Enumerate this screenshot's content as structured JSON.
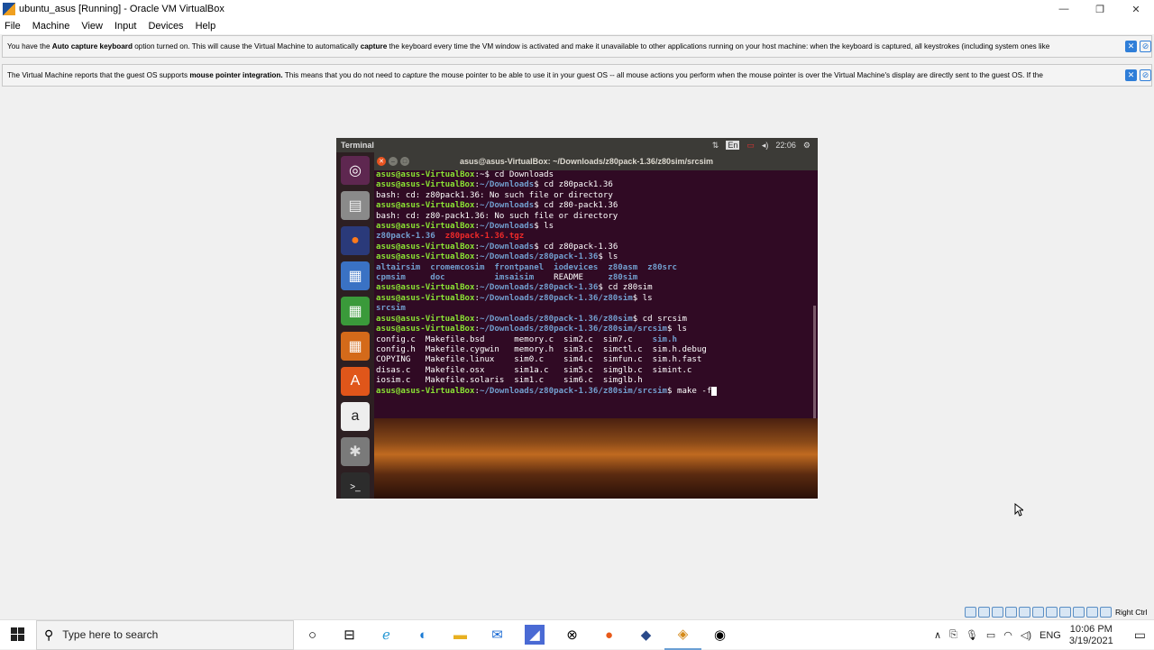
{
  "window": {
    "title": "ubuntu_asus [Running] - Oracle VM VirtualBox",
    "minimize": "—",
    "restore": "❐",
    "close": "✕"
  },
  "menu": [
    "File",
    "Machine",
    "View",
    "Input",
    "Devices",
    "Help"
  ],
  "notices": [
    {
      "parts": [
        {
          "t": "You have the ",
          "b": false
        },
        {
          "t": "Auto capture keyboard",
          "b": true
        },
        {
          "t": " option turned on. This will cause the Virtual Machine to automatically ",
          "b": false
        },
        {
          "t": "capture",
          "b": true
        },
        {
          "t": " the keyboard every time the VM window is activated and make it unavailable to other applications running on your host machine: when the keyboard is captured, all keystrokes (including system ones like",
          "b": false
        }
      ]
    },
    {
      "parts": [
        {
          "t": "The Virtual Machine reports that the guest OS supports ",
          "b": false
        },
        {
          "t": "mouse pointer integration.",
          "b": true
        },
        {
          "t": " This means that you do not need to ",
          "b": false
        },
        {
          "t": "capture",
          "b": false,
          "i": true
        },
        {
          "t": " the mouse pointer to be able to use it in your guest OS -- all mouse actions you perform when the mouse pointer is over the Virtual Machine's display are directly sent to the guest OS. If the",
          "b": false
        }
      ]
    }
  ],
  "guest": {
    "topbar_title": "Terminal",
    "lang": "En",
    "time": "22:06",
    "terminal_title": "asus@asus-VirtualBox: ~/Downloads/z80pack-1.36/z80sim/srcsim",
    "lines": [
      [
        {
          "c": "p-user",
          "t": "asus@asus-VirtualBox"
        },
        {
          "c": "",
          "t": ":~$ cd Downloads"
        }
      ],
      [
        {
          "c": "p-user",
          "t": "asus@asus-VirtualBox"
        },
        {
          "c": "",
          "t": ":"
        },
        {
          "c": "p-path",
          "t": "~/Downloads"
        },
        {
          "c": "",
          "t": "$ cd z80pack1.36"
        }
      ],
      [
        {
          "c": "",
          "t": "bash: cd: z80pack1.36: No such file or directory"
        }
      ],
      [
        {
          "c": "p-user",
          "t": "asus@asus-VirtualBox"
        },
        {
          "c": "",
          "t": ":"
        },
        {
          "c": "p-path",
          "t": "~/Downloads"
        },
        {
          "c": "",
          "t": "$ cd z80-pack1.36"
        }
      ],
      [
        {
          "c": "",
          "t": "bash: cd: z80-pack1.36: No such file or directory"
        }
      ],
      [
        {
          "c": "p-user",
          "t": "asus@asus-VirtualBox"
        },
        {
          "c": "",
          "t": ":"
        },
        {
          "c": "p-path",
          "t": "~/Downloads"
        },
        {
          "c": "",
          "t": "$ ls"
        }
      ],
      [
        {
          "c": "c-dir",
          "t": "z80pack-1.36"
        },
        {
          "c": "",
          "t": "  "
        },
        {
          "c": "c-red",
          "t": "z80pack-1.36.tgz"
        }
      ],
      [
        {
          "c": "p-user",
          "t": "asus@asus-VirtualBox"
        },
        {
          "c": "",
          "t": ":"
        },
        {
          "c": "p-path",
          "t": "~/Downloads"
        },
        {
          "c": "",
          "t": "$ cd z80pack-1.36"
        }
      ],
      [
        {
          "c": "p-user",
          "t": "asus@asus-VirtualBox"
        },
        {
          "c": "",
          "t": ":"
        },
        {
          "c": "p-path",
          "t": "~/Downloads/z80pack-1.36"
        },
        {
          "c": "",
          "t": "$ ls"
        }
      ],
      [
        {
          "c": "c-dir",
          "t": "altairsim  cromemcosim  frontpanel  iodevices  z80asm  z80src"
        }
      ],
      [
        {
          "c": "c-dir",
          "t": "cpmsim     doc          imsaisim    "
        },
        {
          "c": "",
          "t": "README     "
        },
        {
          "c": "c-dir",
          "t": "z80sim"
        }
      ],
      [
        {
          "c": "p-user",
          "t": "asus@asus-VirtualBox"
        },
        {
          "c": "",
          "t": ":"
        },
        {
          "c": "p-path",
          "t": "~/Downloads/z80pack-1.36"
        },
        {
          "c": "",
          "t": "$ cd z80sim"
        }
      ],
      [
        {
          "c": "p-user",
          "t": "asus@asus-VirtualBox"
        },
        {
          "c": "",
          "t": ":"
        },
        {
          "c": "p-path",
          "t": "~/Downloads/z80pack-1.36/z80sim"
        },
        {
          "c": "",
          "t": "$ ls"
        }
      ],
      [
        {
          "c": "c-dir",
          "t": "srcsim"
        }
      ],
      [
        {
          "c": "p-user",
          "t": "asus@asus-VirtualBox"
        },
        {
          "c": "",
          "t": ":"
        },
        {
          "c": "p-path",
          "t": "~/Downloads/z80pack-1.36/z80sim"
        },
        {
          "c": "",
          "t": "$ cd srcsim"
        }
      ],
      [
        {
          "c": "p-user",
          "t": "asus@asus-VirtualBox"
        },
        {
          "c": "",
          "t": ":"
        },
        {
          "c": "p-path",
          "t": "~/Downloads/z80pack-1.36/z80sim/srcsim"
        },
        {
          "c": "",
          "t": "$ ls"
        }
      ],
      [
        {
          "c": "",
          "t": "config.c  Makefile.bsd      memory.c  sim2.c  sim7.c    "
        },
        {
          "c": "c-dir",
          "t": "sim.h"
        }
      ],
      [
        {
          "c": "",
          "t": "config.h  Makefile.cygwin   memory.h  sim3.c  simctl.c  sim.h.debug"
        }
      ],
      [
        {
          "c": "",
          "t": "COPYING   Makefile.linux    sim0.c    sim4.c  simfun.c  sim.h.fast"
        }
      ],
      [
        {
          "c": "",
          "t": "disas.c   Makefile.osx      sim1a.c   sim5.c  simglb.c  simint.c"
        }
      ],
      [
        {
          "c": "",
          "t": "iosim.c   Makefile.solaris  sim1.c    sim6.c  simglb.h"
        }
      ],
      [
        {
          "c": "p-user",
          "t": "asus@asus-VirtualBox"
        },
        {
          "c": "",
          "t": ":"
        },
        {
          "c": "p-path",
          "t": "~/Downloads/z80pack-1.36/z80sim/srcsim"
        },
        {
          "c": "",
          "t": "$ make -f"
        },
        {
          "c": "cursor",
          "t": " "
        }
      ]
    ],
    "launcher": [
      {
        "name": "ubuntu-dash-icon",
        "glyph": "◎",
        "bg": "#5e2750",
        "fg": "#ffffff"
      },
      {
        "name": "files-icon",
        "glyph": "▤",
        "bg": "#8a8a8a",
        "fg": "#eeeeee"
      },
      {
        "name": "firefox-icon",
        "glyph": "●",
        "bg": "#2a3a7a",
        "fg": "#ff7a1a"
      },
      {
        "name": "writer-icon",
        "glyph": "▦",
        "bg": "#3a72c4",
        "fg": "#ffffff"
      },
      {
        "name": "calc-icon",
        "glyph": "▦",
        "bg": "#3a9a3a",
        "fg": "#ffffff"
      },
      {
        "name": "impress-icon",
        "glyph": "▦",
        "bg": "#d46a1a",
        "fg": "#ffffff"
      },
      {
        "name": "software-center-icon",
        "glyph": "A",
        "bg": "#e0561a",
        "fg": "#ffffff"
      },
      {
        "name": "amazon-icon",
        "glyph": "a",
        "bg": "#eeeeee",
        "fg": "#222222"
      },
      {
        "name": "settings-icon",
        "glyph": "✱",
        "bg": "#7a7a7a",
        "fg": "#dddddd"
      },
      {
        "name": "terminal-icon",
        "glyph": ">_",
        "bg": "#2c2c2c",
        "fg": "#ffffff"
      }
    ]
  },
  "statusbar": {
    "host_key": "Right Ctrl"
  },
  "taskbar": {
    "search_placeholder": "Type here to search",
    "lang": "ENG",
    "time": "10:06 PM",
    "date": "3/19/2021"
  }
}
